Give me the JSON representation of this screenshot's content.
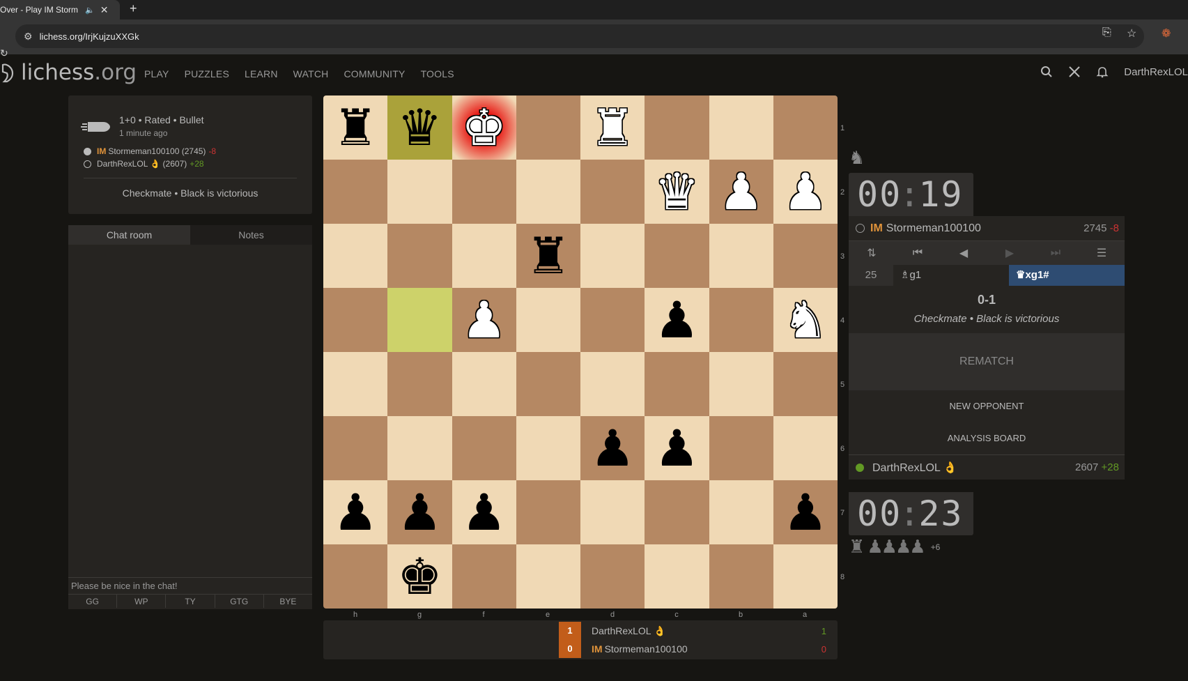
{
  "browser": {
    "tab_title": "e Over - Play IM Storm",
    "new_tab_glyph": "+",
    "url": "lichess.org/IrjKujzuXXGk"
  },
  "header": {
    "logo_main": "lichess",
    "logo_suffix": ".org",
    "nav": [
      "PLAY",
      "PUZZLES",
      "LEARN",
      "WATCH",
      "COMMUNITY",
      "TOOLS"
    ],
    "username": "DarthRexLOL"
  },
  "game_info": {
    "mode": "1+0 • Rated • Bullet",
    "time_ago": "1 minute ago",
    "white_title": "IM",
    "white_player": "Stormeman100100 (2745)",
    "white_diff": "-8",
    "black_player": "DarthRexLOL 👌 (2607)",
    "black_diff": "+28",
    "result": "Checkmate • Black is victorious"
  },
  "chat": {
    "tabs": [
      "Chat room",
      "Notes"
    ],
    "placeholder": "Please be nice in the chat!",
    "quick": [
      "GG",
      "WP",
      "TY",
      "GTG",
      "BYE"
    ]
  },
  "board": {
    "ranks": [
      "1",
      "2",
      "3",
      "4",
      "5",
      "6",
      "7",
      "8"
    ],
    "files": [
      "h",
      "g",
      "f",
      "e",
      "d",
      "c",
      "b",
      "a"
    ],
    "pieces": [
      {
        "row": 0,
        "col": 0,
        "glyph": "♜",
        "color": "b"
      },
      {
        "row": 0,
        "col": 1,
        "glyph": "♛",
        "color": "b"
      },
      {
        "row": 0,
        "col": 2,
        "glyph": "♚",
        "color": "w"
      },
      {
        "row": 0,
        "col": 4,
        "glyph": "♜",
        "color": "w"
      },
      {
        "row": 1,
        "col": 5,
        "glyph": "♛",
        "color": "w"
      },
      {
        "row": 1,
        "col": 6,
        "glyph": "♟",
        "color": "w"
      },
      {
        "row": 1,
        "col": 7,
        "glyph": "♟",
        "color": "w"
      },
      {
        "row": 2,
        "col": 3,
        "glyph": "♜",
        "color": "b"
      },
      {
        "row": 3,
        "col": 2,
        "glyph": "♟",
        "color": "w"
      },
      {
        "row": 3,
        "col": 5,
        "glyph": "♟",
        "color": "b"
      },
      {
        "row": 3,
        "col": 7,
        "glyph": "♞",
        "color": "w"
      },
      {
        "row": 5,
        "col": 4,
        "glyph": "♟",
        "color": "b"
      },
      {
        "row": 5,
        "col": 5,
        "glyph": "♟",
        "color": "b"
      },
      {
        "row": 6,
        "col": 0,
        "glyph": "♟",
        "color": "b"
      },
      {
        "row": 6,
        "col": 1,
        "glyph": "♟",
        "color": "b"
      },
      {
        "row": 6,
        "col": 2,
        "glyph": "♟",
        "color": "b"
      },
      {
        "row": 6,
        "col": 7,
        "glyph": "♟",
        "color": "b"
      },
      {
        "row": 7,
        "col": 1,
        "glyph": "♚",
        "color": "b"
      }
    ],
    "lastmove_squares": [
      [
        0,
        1
      ],
      [
        3,
        1
      ]
    ],
    "check_square": [
      0,
      2
    ]
  },
  "match": {
    "rows": [
      {
        "score": "1",
        "title": "",
        "name": "DarthRexLOL 👌",
        "points": "1",
        "points_color": "#629924"
      },
      {
        "score": "0",
        "title": "IM",
        "name": "Stormeman100100",
        "points": "0",
        "points_color": "#cc3333"
      }
    ]
  },
  "right": {
    "opp_clock_min": "00",
    "opp_clock_sec": "19",
    "opp_title": "IM",
    "opp_name": "Stormeman100100",
    "opp_rating": "2745",
    "opp_diff": "-8",
    "move_number": "25",
    "move_white": "♗g1",
    "move_black": "♛xg1#",
    "score": "0-1",
    "result_text": "Checkmate • Black is victorious",
    "rematch": "REMATCH",
    "new_opponent": "NEW OPPONENT",
    "analysis": "ANALYSIS BOARD",
    "me_name": "DarthRexLOL 👌",
    "me_rating": "2607",
    "me_diff": "+28",
    "me_clock_min": "00",
    "me_clock_sec": "23",
    "material_advantage": "+6"
  }
}
